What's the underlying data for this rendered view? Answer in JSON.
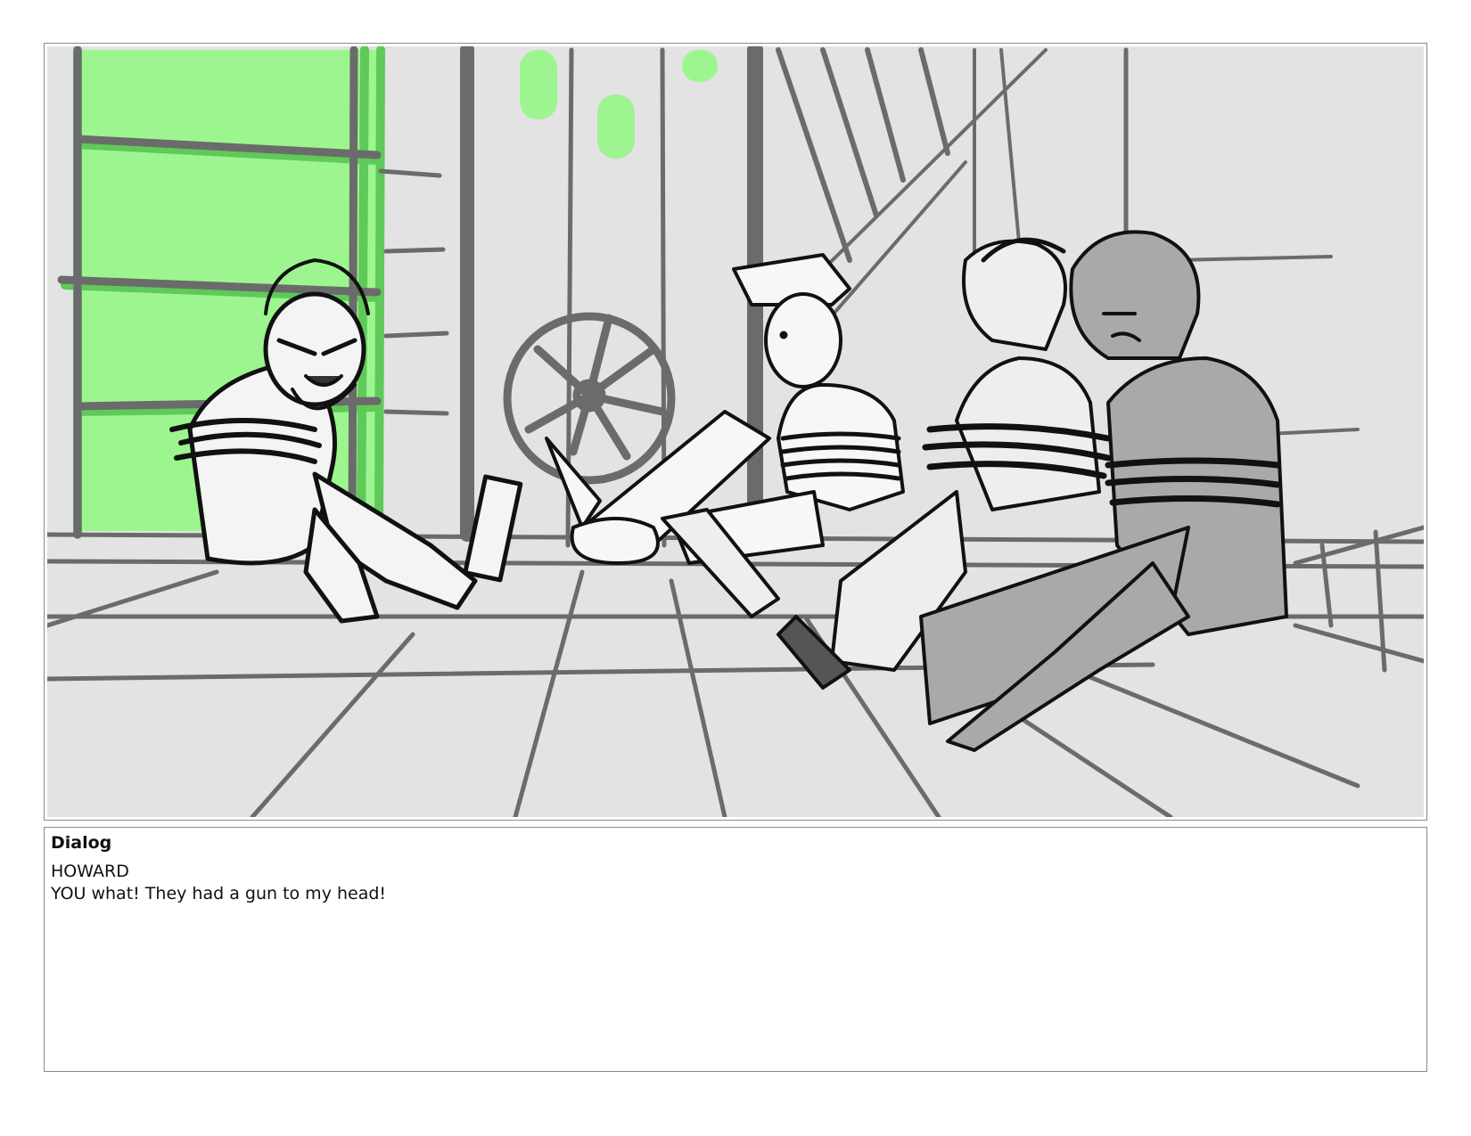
{
  "panel": {
    "description_icon": "storyboard-sketch-image",
    "colors": {
      "background": "#e3e3e3",
      "window_green": "#9df58f",
      "structure_gray": "#6b6b6b",
      "ink": "#111111",
      "shade_gray": "#a9a9a9"
    }
  },
  "dialog": {
    "heading": "Dialog",
    "speaker": "HOWARD",
    "line": "YOU what! They had a gun to my head!"
  }
}
